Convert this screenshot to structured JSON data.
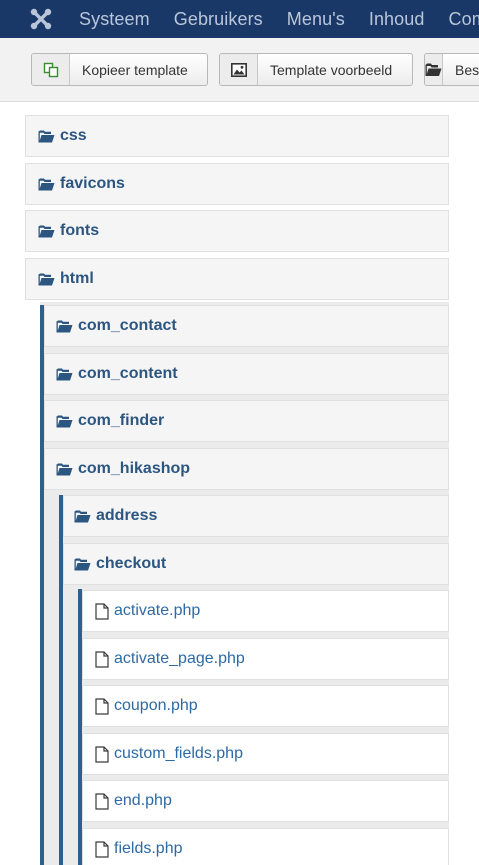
{
  "navbar": {
    "logo_icon": "joomla-logo-icon",
    "items": [
      "Systeem",
      "Gebruikers",
      "Menu's",
      "Inhoud",
      "Componenten"
    ]
  },
  "toolbar": {
    "copy_label": "Kopieer template",
    "copy_icon": "copy-icon",
    "preview_label": "Template voorbeeld",
    "preview_icon": "image-icon",
    "manage_label": "Bestanden beheren",
    "manage_icon": "folder-icon"
  },
  "tree": {
    "css": "css",
    "favicons": "favicons",
    "fonts": "fonts",
    "html": "html",
    "com_contact": "com_contact",
    "com_content": "com_content",
    "com_finder": "com_finder",
    "com_hikashop": "com_hikashop",
    "address": "address",
    "checkout": "checkout",
    "files": [
      "activate.php",
      "activate_page.php",
      "coupon.php",
      "custom_fields.php",
      "end.php",
      "fields.php"
    ]
  },
  "colors": {
    "navbar_bg": "#1a3867",
    "navbar_text": "#b9c6da",
    "folder_text": "#2c5680",
    "file_text": "#2d6aa5",
    "guide": "#2d5f8f"
  }
}
